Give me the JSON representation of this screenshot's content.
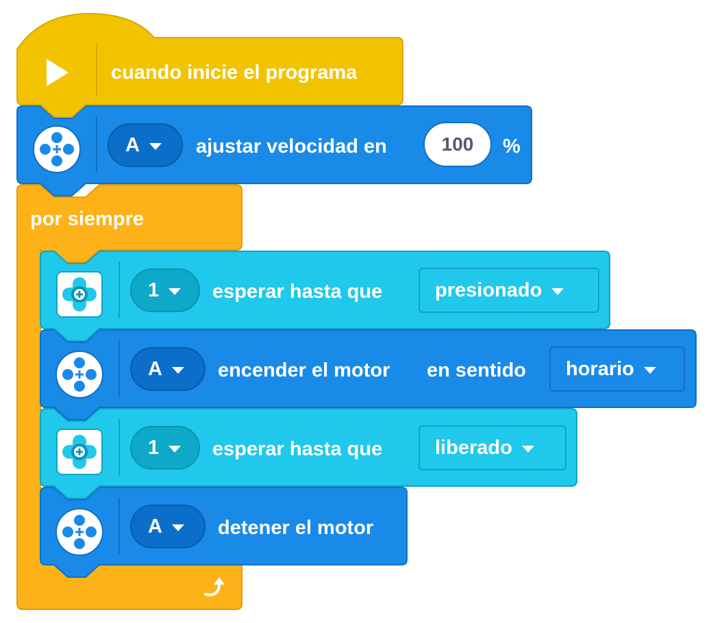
{
  "colors": {
    "event": "#f2c300",
    "control": "#fdb219",
    "motor": "#1a8ae8",
    "button_sensor": "#20c8ec"
  },
  "blocks": {
    "start": {
      "label": "cuando inicie el programa",
      "icon": "play-icon"
    },
    "set_speed": {
      "port": "A",
      "label": "ajustar velocidad en",
      "value": "100",
      "unit": "%",
      "icon": "motor-icon"
    },
    "forever": {
      "label": "por siempre",
      "loop_icon": "loop-arrow-icon"
    },
    "wait_pressed": {
      "port": "1",
      "label": "esperar hasta que",
      "state": "presionado",
      "icon": "force-sensor-icon"
    },
    "start_motor": {
      "port": "A",
      "label": "encender el motor",
      "label2": "en sentido",
      "direction": "horario",
      "icon": "motor-icon"
    },
    "wait_released": {
      "port": "1",
      "label": "esperar hasta que",
      "state": "liberado",
      "icon": "force-sensor-icon"
    },
    "stop_motor": {
      "port": "A",
      "label": "detener el motor",
      "icon": "motor-icon"
    }
  }
}
